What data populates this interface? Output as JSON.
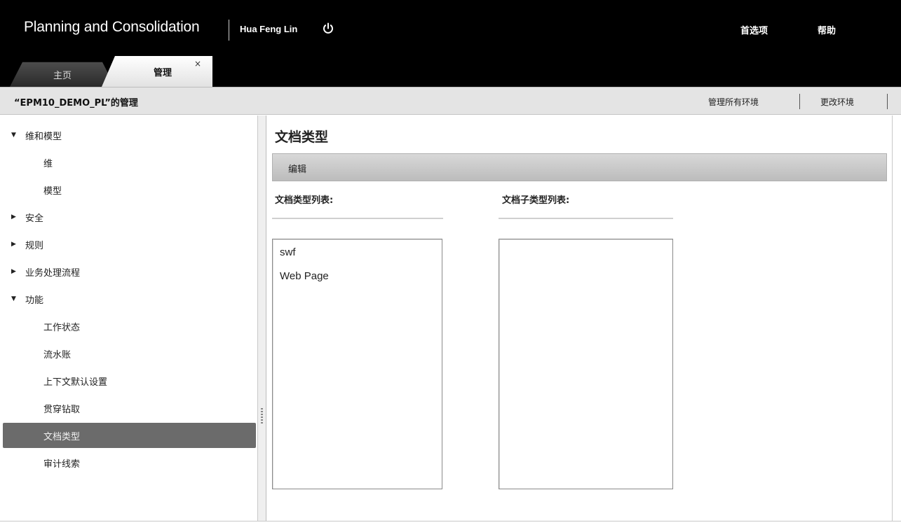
{
  "header": {
    "app_title": "Planning and Consolidation",
    "user_name": "Hua Feng Lin",
    "preferences_label": "首选项",
    "help_label": "帮助"
  },
  "tabs": [
    {
      "label": "主页",
      "active": false
    },
    {
      "label": "管理",
      "active": true,
      "close_glyph": "×"
    }
  ],
  "context": {
    "title": "“EPM10_DEMO_PL”的管理",
    "manage_all_label": "管理所有环境",
    "change_env_label": "更改环境"
  },
  "nav": {
    "items": [
      {
        "label": "维和模型",
        "level": 1,
        "arrow": "▼"
      },
      {
        "label": "维",
        "level": 2
      },
      {
        "label": "模型",
        "level": 2
      },
      {
        "label": "安全",
        "level": 1,
        "arrow": "▶"
      },
      {
        "label": "规则",
        "level": 1,
        "arrow": "▶"
      },
      {
        "label": "业务处理流程",
        "level": 1,
        "arrow": "▶"
      },
      {
        "label": "功能",
        "level": 1,
        "arrow": "▼"
      },
      {
        "label": "工作状态",
        "level": 2
      },
      {
        "label": "流水账",
        "level": 2
      },
      {
        "label": "上下文默认设置",
        "level": 2
      },
      {
        "label": "贯穿钻取",
        "level": 2
      },
      {
        "label": "文档类型",
        "level": 2,
        "selected": true
      },
      {
        "label": "审计线索",
        "level": 2
      }
    ]
  },
  "main": {
    "page_title": "文档类型",
    "edit_label": "编辑",
    "doc_types_label": "文档类型列表:",
    "doc_subtypes_label": "文档子类型列表:",
    "doc_types": [
      "swf",
      "Web Page"
    ],
    "doc_subtypes": []
  },
  "colors": {
    "topbar": "#000000",
    "selected_nav": "#6b6b6b",
    "context_bar": "#e4e4e4"
  },
  "icons": {
    "power": "power-icon",
    "close": "close-icon",
    "expand": "triangle-down-icon",
    "collapse": "triangle-right-icon"
  }
}
